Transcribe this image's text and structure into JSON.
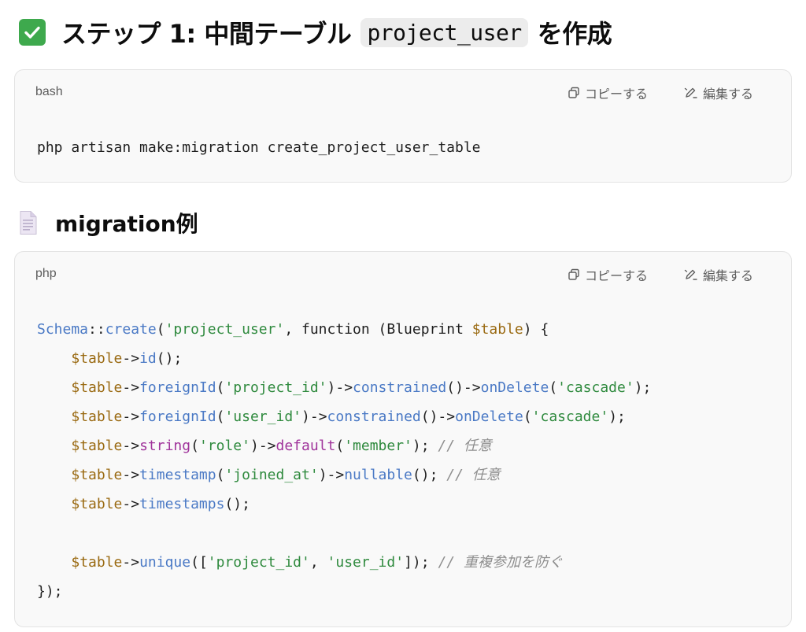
{
  "heading1": {
    "prefix": "ステップ 1: 中間テーブル",
    "code": "project_user",
    "suffix": "を作成"
  },
  "heading2": {
    "text": "migration例"
  },
  "actions": {
    "copy": "コピーする",
    "edit": "編集する"
  },
  "block1": {
    "lang": "bash",
    "line": "php artisan make:migration create_project_user_table"
  },
  "block2": {
    "lang": "php",
    "lines": [
      [
        [
          "cls",
          "Schema"
        ],
        [
          "pl",
          "::"
        ],
        [
          "fn",
          "create"
        ],
        [
          "pl",
          "("
        ],
        [
          "str",
          "'project_user'"
        ],
        [
          "pl",
          ", "
        ],
        [
          "kw",
          "function"
        ],
        [
          "pl",
          " (Blueprint "
        ],
        [
          "var",
          "$table"
        ],
        [
          "pl",
          ") {"
        ]
      ],
      [
        [
          "pl",
          "    "
        ],
        [
          "var",
          "$table"
        ],
        [
          "pl",
          "->"
        ],
        [
          "fn",
          "id"
        ],
        [
          "pl",
          "();"
        ]
      ],
      [
        [
          "pl",
          "    "
        ],
        [
          "var",
          "$table"
        ],
        [
          "pl",
          "->"
        ],
        [
          "fn",
          "foreignId"
        ],
        [
          "pl",
          "("
        ],
        [
          "str",
          "'project_id'"
        ],
        [
          "pl",
          ")->"
        ],
        [
          "fn",
          "constrained"
        ],
        [
          "pl",
          "()->"
        ],
        [
          "fn",
          "onDelete"
        ],
        [
          "pl",
          "("
        ],
        [
          "str",
          "'cascade'"
        ],
        [
          "pl",
          ");"
        ]
      ],
      [
        [
          "pl",
          "    "
        ],
        [
          "var",
          "$table"
        ],
        [
          "pl",
          "->"
        ],
        [
          "fn",
          "foreignId"
        ],
        [
          "pl",
          "("
        ],
        [
          "str",
          "'user_id'"
        ],
        [
          "pl",
          ")->"
        ],
        [
          "fn",
          "constrained"
        ],
        [
          "pl",
          "()->"
        ],
        [
          "fn",
          "onDelete"
        ],
        [
          "pl",
          "("
        ],
        [
          "str",
          "'cascade'"
        ],
        [
          "pl",
          ");"
        ]
      ],
      [
        [
          "pl",
          "    "
        ],
        [
          "var",
          "$table"
        ],
        [
          "pl",
          "->"
        ],
        [
          "mag",
          "string"
        ],
        [
          "pl",
          "("
        ],
        [
          "str",
          "'role'"
        ],
        [
          "pl",
          ")->"
        ],
        [
          "mag",
          "default"
        ],
        [
          "pl",
          "("
        ],
        [
          "str",
          "'member'"
        ],
        [
          "pl",
          "); "
        ],
        [
          "cm",
          "// 任意"
        ]
      ],
      [
        [
          "pl",
          "    "
        ],
        [
          "var",
          "$table"
        ],
        [
          "pl",
          "->"
        ],
        [
          "fn",
          "timestamp"
        ],
        [
          "pl",
          "("
        ],
        [
          "str",
          "'joined_at'"
        ],
        [
          "pl",
          ")->"
        ],
        [
          "fn",
          "nullable"
        ],
        [
          "pl",
          "(); "
        ],
        [
          "cm",
          "// 任意"
        ]
      ],
      [
        [
          "pl",
          "    "
        ],
        [
          "var",
          "$table"
        ],
        [
          "pl",
          "->"
        ],
        [
          "fn",
          "timestamps"
        ],
        [
          "pl",
          "();"
        ]
      ],
      [
        [
          "pl",
          ""
        ]
      ],
      [
        [
          "pl",
          "    "
        ],
        [
          "var",
          "$table"
        ],
        [
          "pl",
          "->"
        ],
        [
          "fn",
          "unique"
        ],
        [
          "pl",
          "(["
        ],
        [
          "str",
          "'project_id'"
        ],
        [
          "pl",
          ", "
        ],
        [
          "str",
          "'user_id'"
        ],
        [
          "pl",
          "]); "
        ],
        [
          "cm",
          "// 重複参加を防ぐ"
        ]
      ],
      [
        [
          "pl",
          "});"
        ]
      ]
    ]
  },
  "colors": {
    "check_bg": "#3ea94d",
    "block_bg": "#f9f9f9"
  }
}
